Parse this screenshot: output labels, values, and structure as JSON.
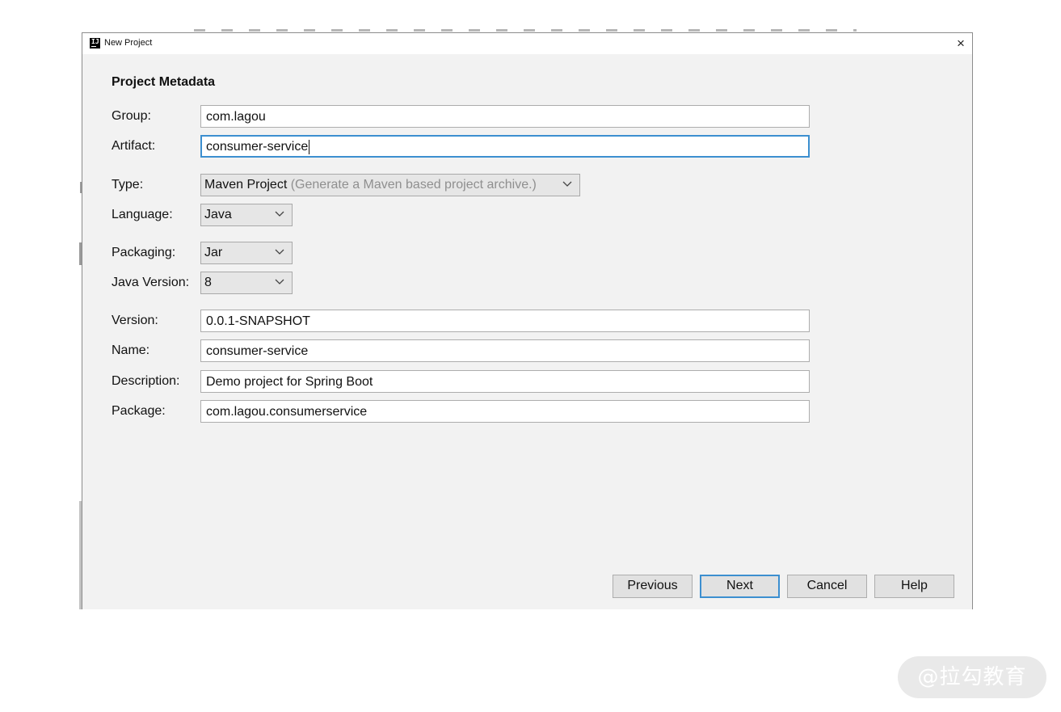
{
  "dialog": {
    "title": "New Project",
    "close_glyph": "×",
    "section_title": "Project Metadata"
  },
  "form": {
    "group": {
      "label": "Group:",
      "value": "com.lagou"
    },
    "artifact": {
      "label": "Artifact:",
      "value": "consumer-service",
      "focused": true
    },
    "type": {
      "label": "Type:",
      "value": "Maven Project",
      "hint": "(Generate a Maven based project archive.)"
    },
    "language": {
      "label": "Language:",
      "value": "Java"
    },
    "packaging": {
      "label": "Packaging:",
      "value": "Jar"
    },
    "java_version": {
      "label": "Java Version:",
      "value": "8"
    },
    "version": {
      "label": "Version:",
      "value": "0.0.1-SNAPSHOT"
    },
    "name": {
      "label": "Name:",
      "value": "consumer-service"
    },
    "description": {
      "label": "Description:",
      "value": "Demo project for Spring Boot"
    },
    "package": {
      "label": "Package:",
      "value": "com.lagou.consumerservice"
    }
  },
  "buttons": {
    "previous": "Previous",
    "next": "Next",
    "cancel": "Cancel",
    "help": "Help"
  },
  "watermark": "@拉勾教育",
  "colors": {
    "focus_accent": "#3c8fd0",
    "dialog_bg": "#f2f2f2"
  }
}
